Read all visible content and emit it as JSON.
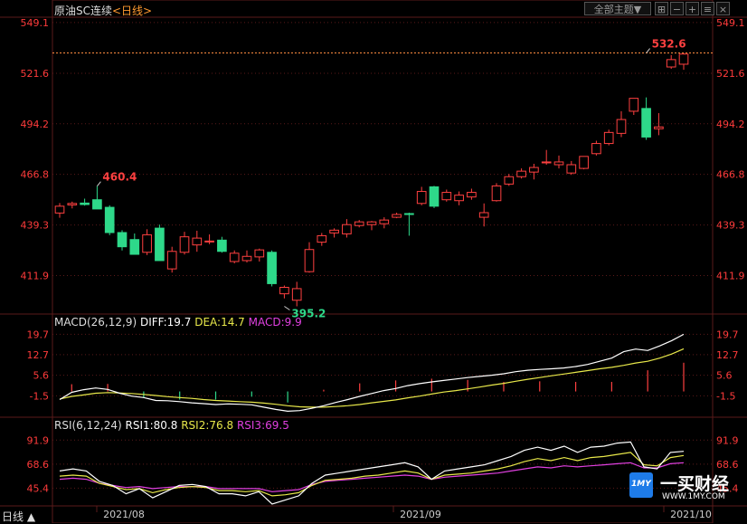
{
  "header": {
    "symbol": "原油SC连续",
    "period": "<日线>"
  },
  "toolbar": {
    "theme_label": "全部主题▼",
    "icons": [
      "grid-icon",
      "minus-icon",
      "plus-icon",
      "menu-icon",
      "close-icon"
    ]
  },
  "footer": {
    "period_label": "日线 ▲"
  },
  "watermark": {
    "name": "一买财经",
    "url": "WWW.1MY.COM",
    "logo": "1MY"
  },
  "colors": {
    "up": "#ff4040",
    "down": "#2ed98a",
    "diff": "#ffffff",
    "dea": "#e8e84a",
    "macd": "#e040e0",
    "rsi1": "#ffffff",
    "rsi2": "#e8e84a",
    "rsi3": "#e040e0",
    "axis": "#ff3b3b",
    "grid": "#5a1a1a"
  },
  "chart_data": [
    {
      "type": "candlestick",
      "yticks": [
        549.1,
        521.6,
        494.2,
        466.8,
        439.3,
        411.9
      ],
      "ylim": [
        392,
        552
      ],
      "xlabels": [
        "2021/08",
        "2021/09",
        "2021/10"
      ],
      "last_price_line": 532.6,
      "annotations": [
        {
          "text": "460.4",
          "value": 460.4,
          "index": 3,
          "kind": "high"
        },
        {
          "text": "395.2",
          "value": 395.2,
          "index": 18,
          "kind": "low"
        },
        {
          "text": "532.6",
          "value": 532.6,
          "index": 47,
          "kind": "high"
        }
      ],
      "candles": [
        [
          445.8,
          451.2,
          443.2,
          449.5
        ],
        [
          450.2,
          452.0,
          448.3,
          451.0
        ],
        [
          451.2,
          453.6,
          449.8,
          450.4
        ],
        [
          453.0,
          460.4,
          448.9,
          448.0
        ],
        [
          448.9,
          450.0,
          433.8,
          435.2
        ],
        [
          435.2,
          436.5,
          425.5,
          427.5
        ],
        [
          431.4,
          434.7,
          423.4,
          423.4
        ],
        [
          424.5,
          437.0,
          423.0,
          434.0
        ],
        [
          437.6,
          439.5,
          420.0,
          420.0
        ],
        [
          415.5,
          427.5,
          413.5,
          425.0
        ],
        [
          424.5,
          435.6,
          423.3,
          432.9
        ],
        [
          428.5,
          436.2,
          424.8,
          432.2
        ],
        [
          430.6,
          434.2,
          428.9,
          430.6
        ],
        [
          431.1,
          432.9,
          424.3,
          425.0
        ],
        [
          419.5,
          425.5,
          418.5,
          424.0
        ],
        [
          420.0,
          425.5,
          419.0,
          422.3
        ],
        [
          422.0,
          426.5,
          419.5,
          425.8
        ],
        [
          424.5,
          425.5,
          406.0,
          407.5
        ],
        [
          402.0,
          406.5,
          399.5,
          405.5
        ],
        [
          398.5,
          408.5,
          395.2,
          404.8
        ],
        [
          414.0,
          430.0,
          413.5,
          426.0
        ],
        [
          430.0,
          435.0,
          428.0,
          433.5
        ],
        [
          435.0,
          437.5,
          432.5,
          436.5
        ],
        [
          434.5,
          442.5,
          432.5,
          439.5
        ],
        [
          439.0,
          442.0,
          438.0,
          441.0
        ],
        [
          439.5,
          441.5,
          436.5,
          441.0
        ],
        [
          440.0,
          443.5,
          437.5,
          442.0
        ],
        [
          443.5,
          446.0,
          443.0,
          445.0
        ],
        [
          445.5,
          446.0,
          433.5,
          445.0
        ],
        [
          451.0,
          460.0,
          450.0,
          457.5
        ],
        [
          460.0,
          460.5,
          448.5,
          449.5
        ],
        [
          453.0,
          458.5,
          452.0,
          457.0
        ],
        [
          452.5,
          457.5,
          450.0,
          455.5
        ],
        [
          454.5,
          459.0,
          453.0,
          457.0
        ],
        [
          443.5,
          451.0,
          438.5,
          446.0
        ],
        [
          452.5,
          462.0,
          452.0,
          460.5
        ],
        [
          461.5,
          467.0,
          460.5,
          465.5
        ],
        [
          465.5,
          470.0,
          464.5,
          468.5
        ],
        [
          468.0,
          472.5,
          464.0,
          470.5
        ],
        [
          473.0,
          480.0,
          472.0,
          473.5
        ],
        [
          472.0,
          477.0,
          470.0,
          473.5
        ],
        [
          467.5,
          474.0,
          466.5,
          472.0
        ],
        [
          470.0,
          476.5,
          469.5,
          476.5
        ],
        [
          478.0,
          485.0,
          477.0,
          483.5
        ],
        [
          483.5,
          491.0,
          482.5,
          489.5
        ],
        [
          489.0,
          501.0,
          487.0,
          496.5
        ],
        [
          501.0,
          508.0,
          499.0,
          508.0
        ],
        [
          502.5,
          508.5,
          485.5,
          487.0
        ],
        [
          491.5,
          500.0,
          488.0,
          492.5
        ],
        [
          525.0,
          531.5,
          524.0,
          529.0
        ],
        [
          526.5,
          532.6,
          523.5,
          532.0
        ]
      ]
    },
    {
      "type": "macd",
      "legend": {
        "title": "MACD(26,12,9)",
        "diff": "DIFF:19.7",
        "dea": "DEA:14.7",
        "macd": "MACD:9.9"
      },
      "yticks": [
        19.7,
        12.7,
        5.6,
        -1.5
      ],
      "ylim": [
        -7,
        22
      ],
      "diff": [
        -2.8,
        -0.3,
        0.6,
        1.2,
        0.7,
        -0.6,
        -1.6,
        -2.1,
        -3.1,
        -3.2,
        -3.5,
        -3.9,
        -4.2,
        -4.5,
        -4.3,
        -4.4,
        -4.6,
        -5.4,
        -6.2,
        -6.8,
        -6.6,
        -5.8,
        -4.9,
        -3.8,
        -2.8,
        -1.7,
        -0.7,
        0.3,
        1.0,
        2.0,
        2.7,
        3.3,
        3.8,
        4.3,
        4.8,
        5.2,
        5.6,
        6.1,
        6.8,
        7.3,
        7.6,
        7.8,
        8.1,
        8.6,
        9.3,
        10.4,
        11.5,
        13.7,
        14.6,
        14.1,
        15.7,
        17.5,
        19.7
      ],
      "dea": [
        -2.6,
        -1.7,
        -1.2,
        -0.6,
        -0.4,
        -0.5,
        -0.7,
        -1.0,
        -1.4,
        -1.8,
        -2.1,
        -2.4,
        -2.8,
        -3.1,
        -3.3,
        -3.5,
        -3.7,
        -4.0,
        -4.4,
        -4.9,
        -5.3,
        -5.4,
        -5.4,
        -5.2,
        -4.9,
        -4.5,
        -3.9,
        -3.4,
        -2.9,
        -2.2,
        -1.6,
        -0.9,
        -0.2,
        0.3,
        0.9,
        1.5,
        2.2,
        2.8,
        3.5,
        4.2,
        4.8,
        5.4,
        6.0,
        6.6,
        7.2,
        7.8,
        8.3,
        9.0,
        9.8,
        10.4,
        11.5,
        12.9,
        14.7
      ],
      "macd": [
        -3.0,
        2.5,
        3.0,
        3.4,
        2.6,
        -0.3,
        -1.8,
        -2.2,
        -3.3,
        -3.0,
        -2.8,
        -3.0,
        -2.8,
        -2.8,
        -2.0,
        -1.8,
        -1.8,
        -2.8,
        -3.6,
        -3.8,
        -2.6,
        -0.8,
        0.6,
        1.6,
        2.2,
        2.8,
        3.4,
        3.4,
        3.8,
        4.4,
        4.4,
        4.4,
        4.6,
        4.4,
        4.0,
        3.6,
        3.4,
        3.3,
        3.3,
        3.2,
        3.5,
        3.4,
        3.3,
        3.3,
        3.3,
        3.3,
        3.3,
        5.0,
        5.2,
        7.3,
        8.4,
        9.2,
        9.9
      ]
    },
    {
      "type": "rsi",
      "legend": {
        "title": "RSI(6,12,24)",
        "rsi1": "RSI1:80.8",
        "rsi2": "RSI2:76.8",
        "rsi3": "RSI3:69.5"
      },
      "yticks": [
        91.9,
        68.6,
        45.4
      ],
      "ylim": [
        30,
        100
      ],
      "rsi1": [
        62,
        64,
        62,
        52,
        48,
        40,
        45,
        36,
        42,
        48,
        49,
        47,
        40,
        40,
        38,
        42,
        30,
        34,
        38,
        50,
        58,
        60,
        62,
        64,
        66,
        68,
        70,
        66,
        54,
        62,
        64,
        66,
        68,
        72,
        76,
        82,
        85,
        82,
        86,
        80,
        85,
        86,
        89,
        90,
        66,
        64,
        80,
        81
      ],
      "rsi2": [
        57,
        58,
        57,
        50,
        47,
        44,
        45,
        41,
        44,
        46,
        47,
        46,
        43,
        43,
        42,
        43,
        38,
        39,
        41,
        48,
        53,
        54,
        55,
        57,
        58,
        60,
        62,
        60,
        54,
        58,
        59,
        60,
        62,
        64,
        67,
        71,
        74,
        72,
        75,
        72,
        75,
        76,
        78,
        80,
        68,
        67,
        75,
        77
      ],
      "rsi3": [
        54,
        55,
        54,
        50,
        48,
        46,
        47,
        45,
        46,
        47,
        47,
        47,
        45,
        45,
        45,
        45,
        42,
        43,
        44,
        49,
        52,
        53,
        54,
        55,
        56,
        57,
        58,
        57,
        54,
        56,
        57,
        58,
        59,
        60,
        62,
        64,
        66,
        65,
        67,
        66,
        67,
        68,
        69,
        70,
        65,
        65,
        69,
        70
      ]
    }
  ]
}
